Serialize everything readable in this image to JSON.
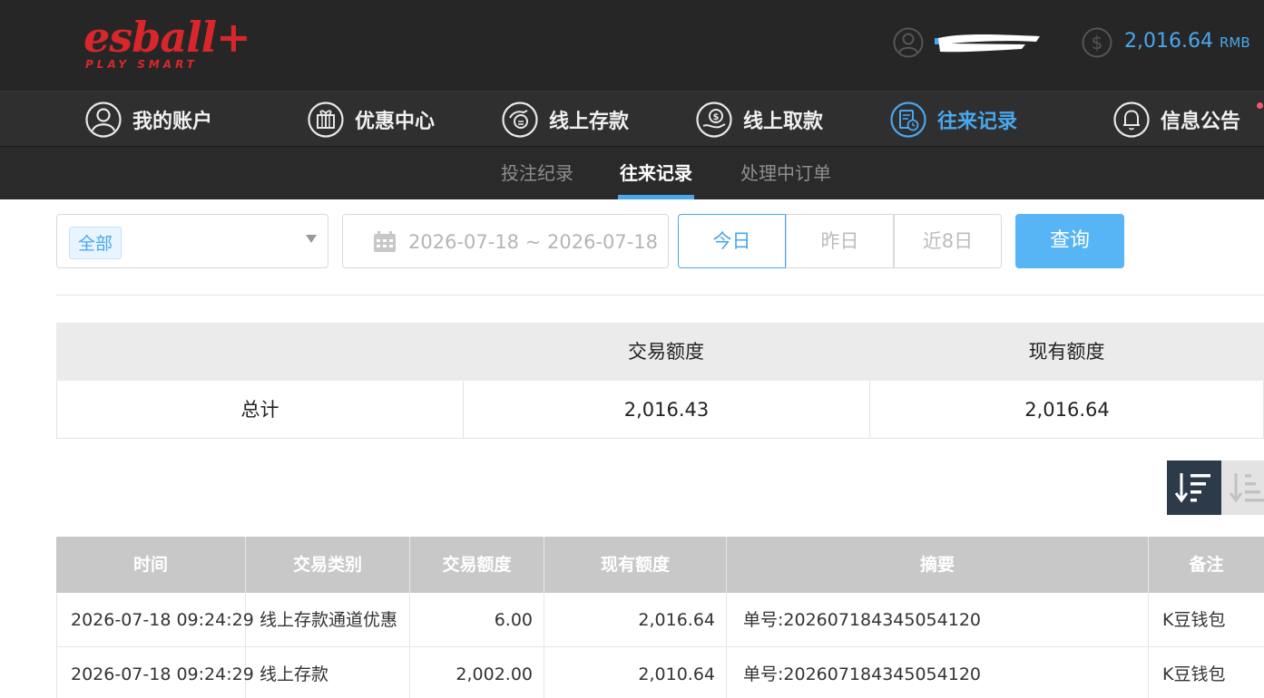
{
  "brand": {
    "logo_text": "esball+",
    "slogan": "PLAY SMART"
  },
  "header": {
    "balance_amount": "2,016.64",
    "balance_currency": "RMB"
  },
  "main_nav": [
    {
      "label": "我的账户",
      "icon": "user-circle-icon"
    },
    {
      "label": "优惠中心",
      "icon": "gift-icon"
    },
    {
      "label": "线上存款",
      "icon": "deposit-hand-icon"
    },
    {
      "label": "线上取款",
      "icon": "withdraw-hand-icon"
    },
    {
      "label": "往来记录",
      "icon": "record-clock-icon",
      "active": true
    },
    {
      "label": "信息公告",
      "icon": "bell-icon"
    }
  ],
  "sub_nav": [
    {
      "label": "投注纪录"
    },
    {
      "label": "往来记录",
      "active": true
    },
    {
      "label": "处理中订单"
    }
  ],
  "filters": {
    "type_selected": "全部",
    "date_range": "2026-07-18 ~ 2026-07-18",
    "quick_dates": [
      "今日",
      "昨日",
      "近8日"
    ],
    "quick_active": "今日",
    "query_label": "查询"
  },
  "summary": {
    "headers": [
      "",
      "交易额度",
      "现有额度"
    ],
    "row": {
      "label": "总计",
      "transaction": "2,016.43",
      "current": "2,016.64"
    }
  },
  "sort": {
    "desc_icon": "sort-desc-icon",
    "asc_icon": "sort-asc-icon"
  },
  "records": {
    "headers": [
      "时间",
      "交易类别",
      "交易额度",
      "现有额度",
      "摘要",
      "备注"
    ],
    "rows": [
      {
        "time": "2026-07-18 09:24:29",
        "type": "线上存款通道优惠",
        "amount": "6.00",
        "balance": "2,016.64",
        "summary": "单号:202607184345054120",
        "note": "K豆钱包"
      },
      {
        "time": "2026-07-18 09:24:29",
        "type": "线上存款",
        "amount": "2,002.00",
        "balance": "2,010.64",
        "summary": "单号:202607184345054120",
        "note": "K豆钱包"
      }
    ]
  },
  "colors": {
    "accent": "#49a7ee",
    "brand_red": "#d8262b",
    "header_bg": "#262626",
    "query_button": "#58b5f5"
  }
}
